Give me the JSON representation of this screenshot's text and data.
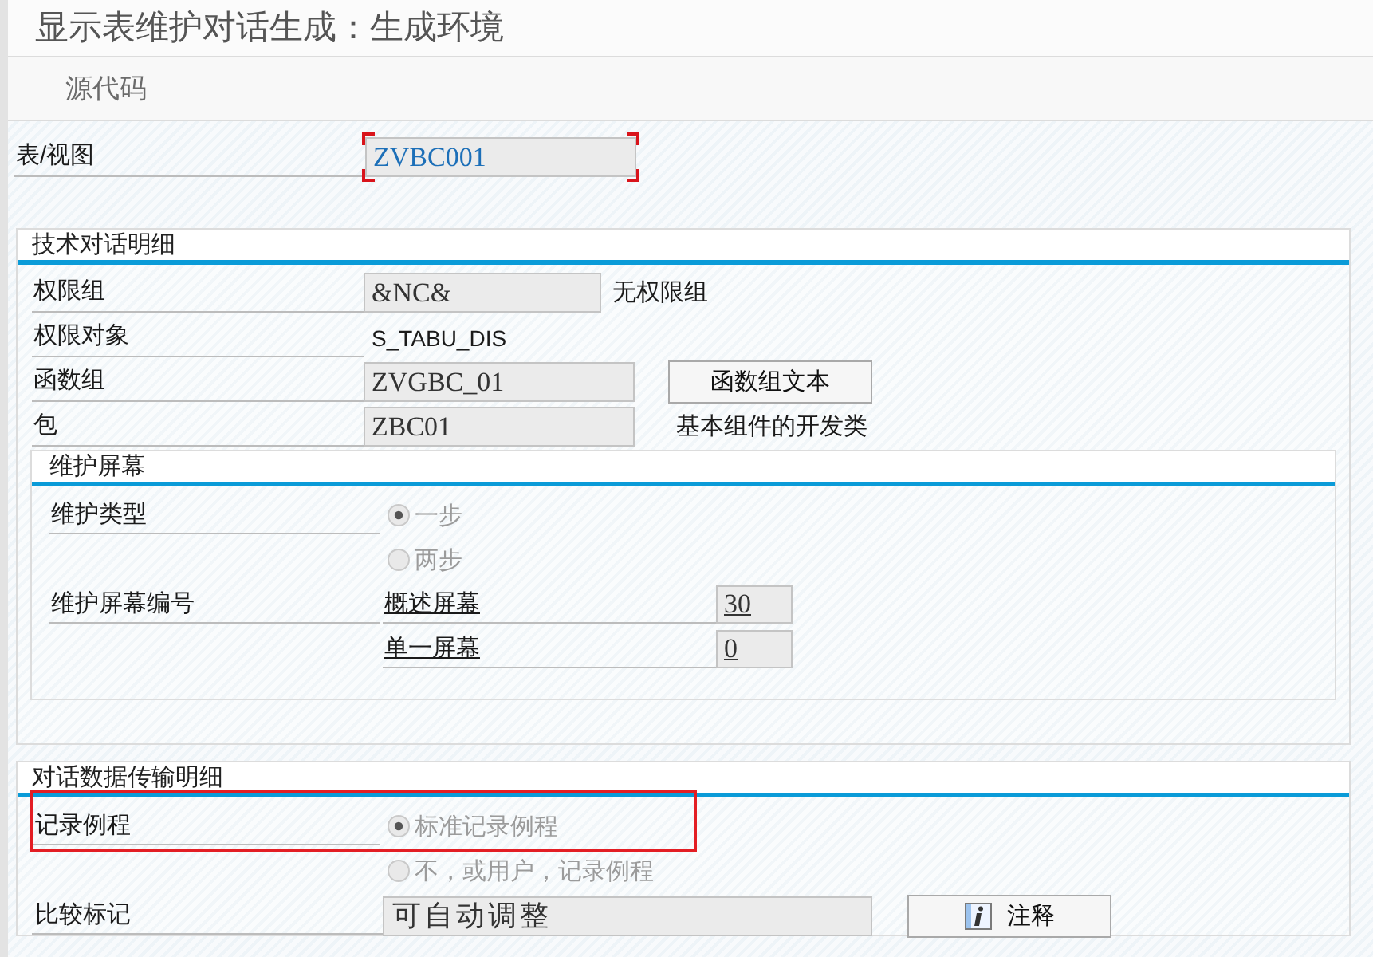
{
  "window": {
    "title": "显示表维护对话生成：生成环境"
  },
  "toolbar": [
    {
      "label": "源代码"
    }
  ],
  "table_view": {
    "label": "表/视图",
    "value": "ZVBC001",
    "focused": true
  },
  "technical_details": {
    "title": "技术对话明细",
    "rows": [
      {
        "kind": "field",
        "label": "权限组",
        "value": "&NC&",
        "description": "无权限组"
      },
      {
        "kind": "text",
        "label": "权限对象",
        "value": "S_TABU_DIS"
      },
      {
        "kind": "field",
        "label": "函数组",
        "value": "ZVGBC_01",
        "button": "函数组文本"
      },
      {
        "kind": "field",
        "label": "包",
        "value": "ZBC01",
        "description": "基本组件的开发类"
      }
    ],
    "maintenance_screens": {
      "title": "维护屏幕",
      "maintenance_type": {
        "label": "维护类型",
        "options": [
          {
            "label": "一步",
            "selected": true,
            "disabled": true
          },
          {
            "label": "两步",
            "selected": false,
            "disabled": true
          }
        ]
      },
      "screen_numbers": {
        "label": "维护屏幕编号",
        "rows": [
          {
            "label": "概述屏幕",
            "value": "30"
          },
          {
            "label": "单一屏幕",
            "value": "0"
          }
        ]
      }
    }
  },
  "data_transport": {
    "title": "对话数据传输明细",
    "recording_routine": {
      "label": "记录例程",
      "highlighted": true,
      "options": [
        {
          "label": "标准记录例程",
          "selected": true,
          "disabled": true
        },
        {
          "label": "不，或用户，记录例程",
          "selected": false,
          "disabled": true
        }
      ]
    },
    "compare_flag": {
      "label": "比较标记",
      "value": "可自动调整",
      "button": "注释"
    }
  }
}
